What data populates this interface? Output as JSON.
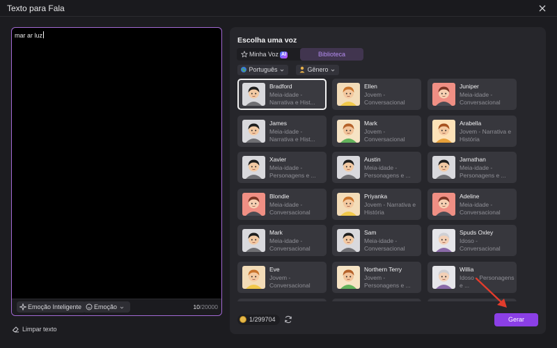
{
  "window": {
    "title": "Texto para Fala"
  },
  "editor": {
    "text": "mar ar luz",
    "emotion_ai_label": "Emoção Inteligente",
    "emotion_label": "Emoção",
    "char_count_current": "10",
    "char_count_max": "/20000"
  },
  "clear_text_label": "Limpar texto",
  "panel": {
    "title": "Escolha uma voz",
    "tabs": {
      "my_voice": "Minha Voz",
      "ai_badge": "AI",
      "library": "Biblioteca"
    },
    "filters": {
      "language": "Português",
      "gender": "Gênero"
    },
    "voices": [
      {
        "name": "Bradford",
        "desc": "Meia-idade - Narrativa e Hist...",
        "avatar": "man-curly-dark",
        "selected": true
      },
      {
        "name": "Ellen",
        "desc": "Jovem - Conversacional",
        "avatar": "girl-blonde-yellow"
      },
      {
        "name": "Juniper",
        "desc": "Meia-idade - Conversacional",
        "avatar": "woman-red"
      },
      {
        "name": "James",
        "desc": "Meia-idade - Narrativa e Hist...",
        "avatar": "man-curly-dark"
      },
      {
        "name": "Mark",
        "desc": "Jovem - Conversacional",
        "avatar": "boy-green"
      },
      {
        "name": "Arabella",
        "desc": "Jovem - Narrativa e História",
        "avatar": "girl-braids"
      },
      {
        "name": "Xavier",
        "desc": "Meia-idade - Personagens e ...",
        "avatar": "man-curly-dark"
      },
      {
        "name": "Austin",
        "desc": "Meia-idade - Personagens e ...",
        "avatar": "man-curly-dark"
      },
      {
        "name": "Jarnathan",
        "desc": "Meia-idade - Personagens e ...",
        "avatar": "man-curly-dark"
      },
      {
        "name": "Blondie",
        "desc": "Meia-idade - Conversacional",
        "avatar": "woman-red"
      },
      {
        "name": "Priyanka",
        "desc": "Jovem - Narrativa e História",
        "avatar": "girl-blonde-yellow"
      },
      {
        "name": "Adeline",
        "desc": "Meia-idade - Conversacional",
        "avatar": "woman-red"
      },
      {
        "name": "Mark",
        "desc": "Meia-idade - Conversacional",
        "avatar": "man-curly-dark"
      },
      {
        "name": "Sam",
        "desc": "Meia-idade - Conversacional",
        "avatar": "man-curly-dark"
      },
      {
        "name": "Spuds Oxley",
        "desc": "Idoso - Conversacional",
        "avatar": "elder"
      },
      {
        "name": "Eve",
        "desc": "Jovem - Conversacional",
        "avatar": "girl-blonde-yellow"
      },
      {
        "name": "Northern Terry",
        "desc": "Jovem - Personagens e ...",
        "avatar": "boy-green"
      },
      {
        "name": "Willia",
        "desc": "Idoso - Personagens e ...",
        "avatar": "elder"
      }
    ],
    "credits": "1/299704",
    "generate_label": "Gerar"
  },
  "colors": {
    "accent": "#8b3fe6",
    "selected_border": "#f2f2f2",
    "editor_border": "#a46bd6"
  }
}
